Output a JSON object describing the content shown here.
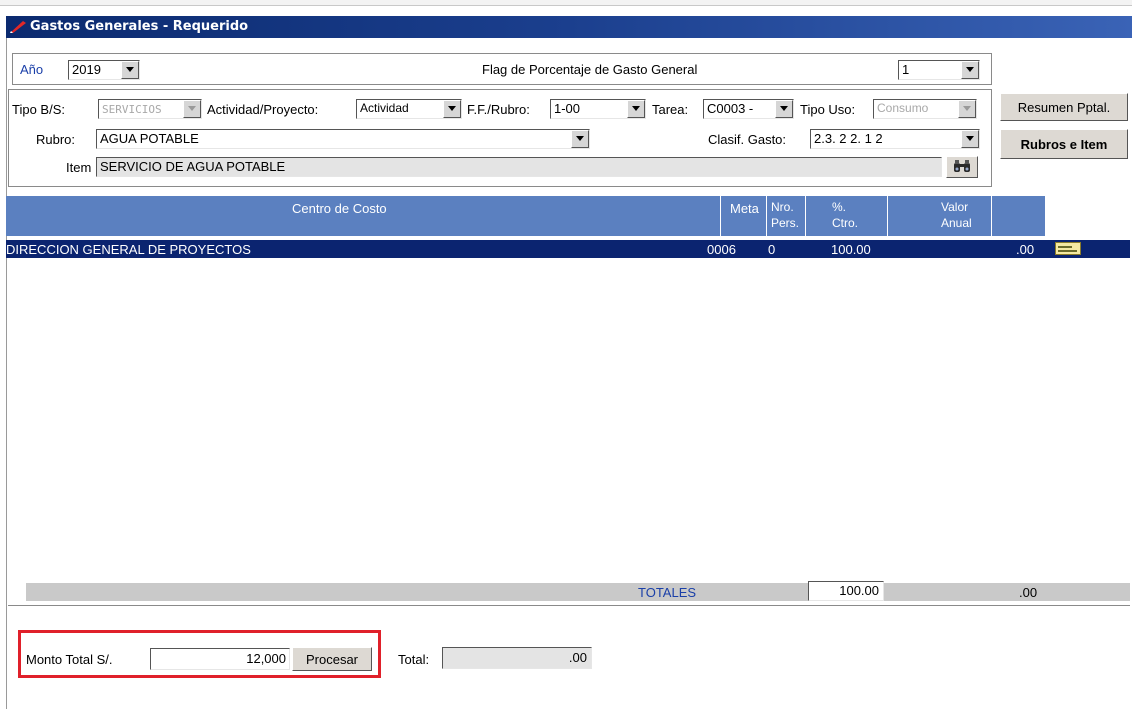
{
  "window": {
    "title": "Gastos Generales - Requerido"
  },
  "year": {
    "label": "Año",
    "value": "2019"
  },
  "flag": {
    "label": "Flag de Porcentaje de Gasto General",
    "value": "1"
  },
  "filters": {
    "tipo_bs_label": "Tipo B/S:",
    "tipo_bs_value": "SERVICIOS",
    "actividad_label": "Actividad/Proyecto:",
    "actividad_value": "Actividad",
    "ff_label": "F.F./Rubro:",
    "ff_value": "1-00",
    "tarea_label": "Tarea:",
    "tarea_value": "C0003 -",
    "tipo_uso_label": "Tipo Uso:",
    "tipo_uso_value": "Consumo",
    "rubro_label": "Rubro:",
    "rubro_value": "AGUA POTABLE",
    "clasif_label": "Clasif. Gasto:",
    "clasif_value": "2.3. 2  2. 1  2",
    "item_label": "Item",
    "item_value": "SERVICIO DE AGUA POTABLE"
  },
  "buttons": {
    "resumen": "Resumen Pptal.",
    "rubros": "Rubros e Item",
    "procesar": "Procesar"
  },
  "grid": {
    "columns": {
      "centro": "Centro de Costo",
      "meta": "Meta",
      "nro1": "Nro.",
      "nro2": "Pers.",
      "pct1": "%.",
      "pct2": "Ctro.",
      "valor1": "Valor",
      "valor2": "Anual"
    },
    "rows": [
      {
        "centro": "DIRECCION GENERAL DE PROYECTOS",
        "meta": "0006",
        "nro": "0",
        "pct": "100.00",
        "valor": ".00"
      }
    ],
    "totals": {
      "label": "TOTALES",
      "pct": "100.00",
      "valor": ".00"
    }
  },
  "footer": {
    "monto_label": "Monto Total S/.",
    "monto_value": "12,000",
    "total_label": "Total:",
    "total_value": ".00"
  },
  "colors": {
    "highlight_box": "#e0202a",
    "selected_row": "#0b2470",
    "header": "#5b80c0"
  },
  "icons": [
    "pencil-logo-icon",
    "binoculars-icon",
    "edit-row-icon",
    "chevron-down-icon"
  ]
}
